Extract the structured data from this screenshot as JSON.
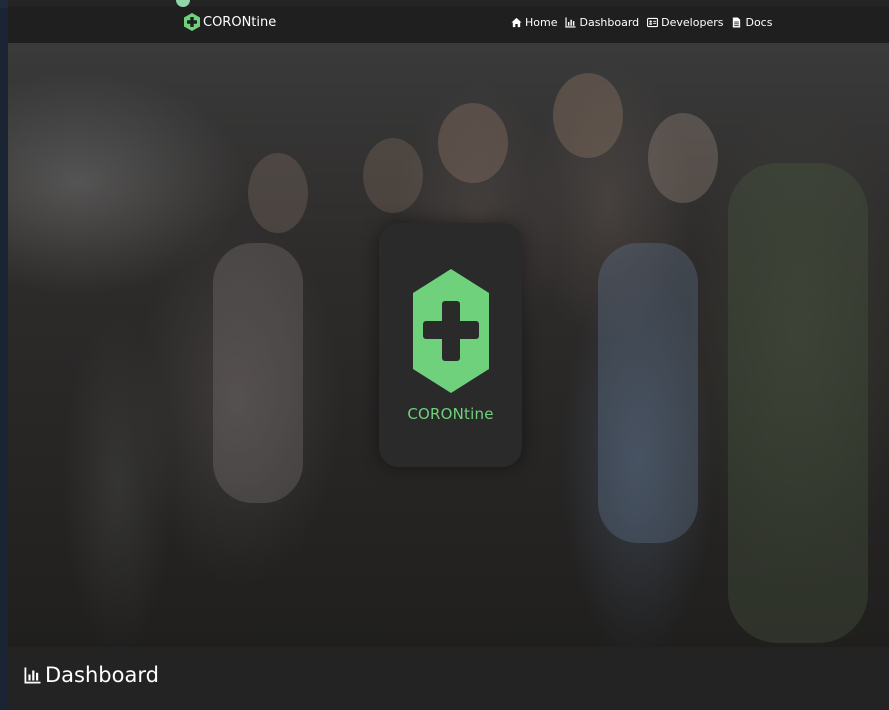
{
  "navbar": {
    "brand": "CORONtine",
    "links": [
      {
        "label": "Home",
        "icon": "home-icon"
      },
      {
        "label": "Dashboard",
        "icon": "chart-icon"
      },
      {
        "label": "Developers",
        "icon": "id-card-icon"
      },
      {
        "label": "Docs",
        "icon": "document-icon"
      }
    ]
  },
  "hero": {
    "logo_text": "CORONtine",
    "logo_icon": "hexagon-plus-icon",
    "background": "crowd-wearing-masks-photo"
  },
  "section": {
    "title": "Dashboard",
    "icon": "chart-icon"
  },
  "colors": {
    "accent": "#6fd17b",
    "navbar_bg": "#1f1f1f",
    "page_bg": "#242424",
    "card_bg": "#2a2a2a"
  }
}
